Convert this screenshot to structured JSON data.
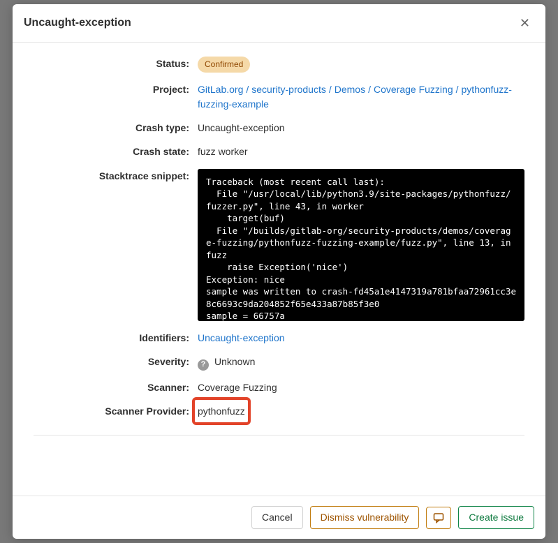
{
  "modal": {
    "title": "Uncaught-exception"
  },
  "fields": {
    "status_label": "Status:",
    "status_value": "Confirmed",
    "project_label": "Project:",
    "project_parts": [
      "GitLab.org",
      "security-products",
      "Demos",
      "Coverage Fuzzing",
      "pythonfuzz-fuzzing-example"
    ],
    "crash_type_label": "Crash type:",
    "crash_type_value": "Uncaught-exception",
    "crash_state_label": "Crash state:",
    "crash_state_value": "fuzz worker",
    "stacktrace_label": "Stacktrace snippet:",
    "stacktrace_value": "Traceback (most recent call last):\n  File \"/usr/local/lib/python3.9/site-packages/pythonfuzz/fuzzer.py\", line 43, in worker\n    target(buf)\n  File \"/builds/gitlab-org/security-products/demos/coverage-fuzzing/pythonfuzz-fuzzing-example/fuzz.py\", line 13, in fuzz\n    raise Exception('nice')\nException: nice\nsample was written to crash-fd45a1e4147319a781bfaa72961cc3e8c6693c9da204852f65e433a87b85f3e0\nsample = 66757a",
    "identifiers_label": "Identifiers:",
    "identifiers_value": "Uncaught-exception",
    "severity_label": "Severity:",
    "severity_value": "Unknown",
    "scanner_label": "Scanner:",
    "scanner_value": "Coverage Fuzzing",
    "provider_label": "Scanner Provider:",
    "provider_value": "pythonfuzz"
  },
  "footer": {
    "cancel": "Cancel",
    "dismiss": "Dismiss vulnerability",
    "create_issue": "Create issue"
  }
}
